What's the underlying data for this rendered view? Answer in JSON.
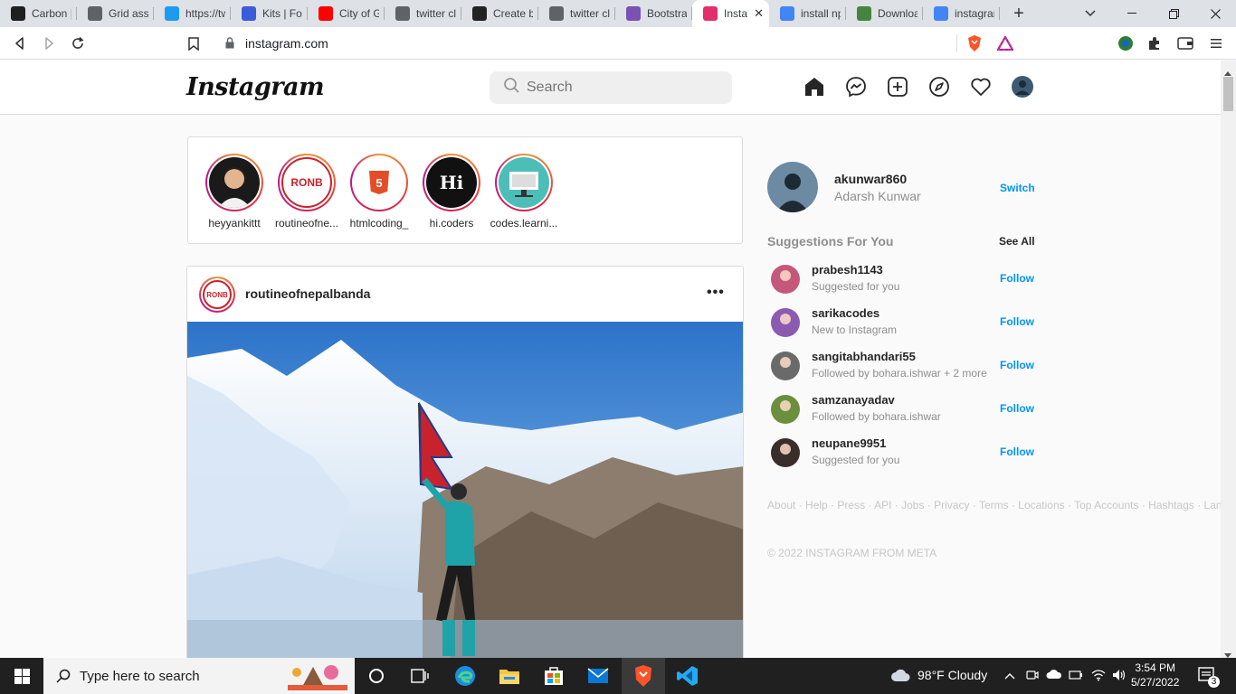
{
  "browser": {
    "tabs": [
      {
        "label": "Carbon |",
        "icon": "carbon-icon",
        "color": "#1f1f1f"
      },
      {
        "label": "Grid assis",
        "icon": "globe-icon",
        "color": "#5f6368"
      },
      {
        "label": "https://tw",
        "icon": "twitter-icon",
        "color": "#1d9bf0"
      },
      {
        "label": "Kits | For",
        "icon": "flag-icon",
        "color": "#3b5bdb"
      },
      {
        "label": "City of G",
        "icon": "youtube-icon",
        "color": "#ff0000"
      },
      {
        "label": "twitter cl",
        "icon": "globe-icon",
        "color": "#5f6368"
      },
      {
        "label": "Create b",
        "icon": "create-icon",
        "color": "#222222"
      },
      {
        "label": "twitter cl",
        "icon": "globe-icon",
        "color": "#5f6368"
      },
      {
        "label": "Bootstra",
        "icon": "bootstrap-icon",
        "color": "#7952b3"
      },
      {
        "label": "Insta",
        "icon": "instagram-icon",
        "color": "#e1306c",
        "active": true
      },
      {
        "label": "install np",
        "icon": "google-icon",
        "color": "#4285f4"
      },
      {
        "label": "Downloa",
        "icon": "node-icon",
        "color": "#43853d"
      },
      {
        "label": "instagran",
        "icon": "google-icon",
        "color": "#4285f4"
      }
    ],
    "url": "instagram.com"
  },
  "header": {
    "logo": "Instagram",
    "search_placeholder": "Search"
  },
  "stories": [
    {
      "name": "heyyankittt",
      "pic_text": "",
      "bg": "#1a1a1a"
    },
    {
      "name": "routineofne...",
      "pic_text": "RONB",
      "bg": "#ffffff"
    },
    {
      "name": "htmlcoding_",
      "pic_text": "5",
      "bg": "#ffffff"
    },
    {
      "name": "hi.coders",
      "pic_text": "Hi",
      "bg": "#111111"
    },
    {
      "name": "codes.learni...",
      "pic_text": "",
      "bg": "#4dbdb8"
    }
  ],
  "post": {
    "username": "routineofnepalbanda",
    "avatar_text": "RONB",
    "more": "•••"
  },
  "sidebar": {
    "username": "akunwar860",
    "fullname": "Adarsh Kunwar",
    "switch": "Switch",
    "suggestions_title": "Suggestions For You",
    "see_all": "See All",
    "suggestions": [
      {
        "username": "prabesh1143",
        "sub": "Suggested for you",
        "follow": "Follow"
      },
      {
        "username": "sarikacodes",
        "sub": "New to Instagram",
        "follow": "Follow"
      },
      {
        "username": "sangitabhandari55",
        "sub": "Followed by bohara.ishwar + 2 more",
        "follow": "Follow"
      },
      {
        "username": "samzanayadav",
        "sub": "Followed by bohara.ishwar",
        "follow": "Follow"
      },
      {
        "username": "neupane9951",
        "sub": "Suggested for you",
        "follow": "Follow"
      }
    ],
    "footer_links": [
      "About",
      "Help",
      "Press",
      "API",
      "Jobs",
      "Privacy",
      "Terms",
      "Locations",
      "Top Accounts",
      "Hashtags",
      "Language"
    ],
    "copyright": "© 2022 INSTAGRAM FROM META"
  },
  "taskbar": {
    "search_placeholder": "Type here to search",
    "weather": "98°F  Cloudy",
    "time": "3:54 PM",
    "date": "5/27/2022",
    "notifications": "3"
  }
}
